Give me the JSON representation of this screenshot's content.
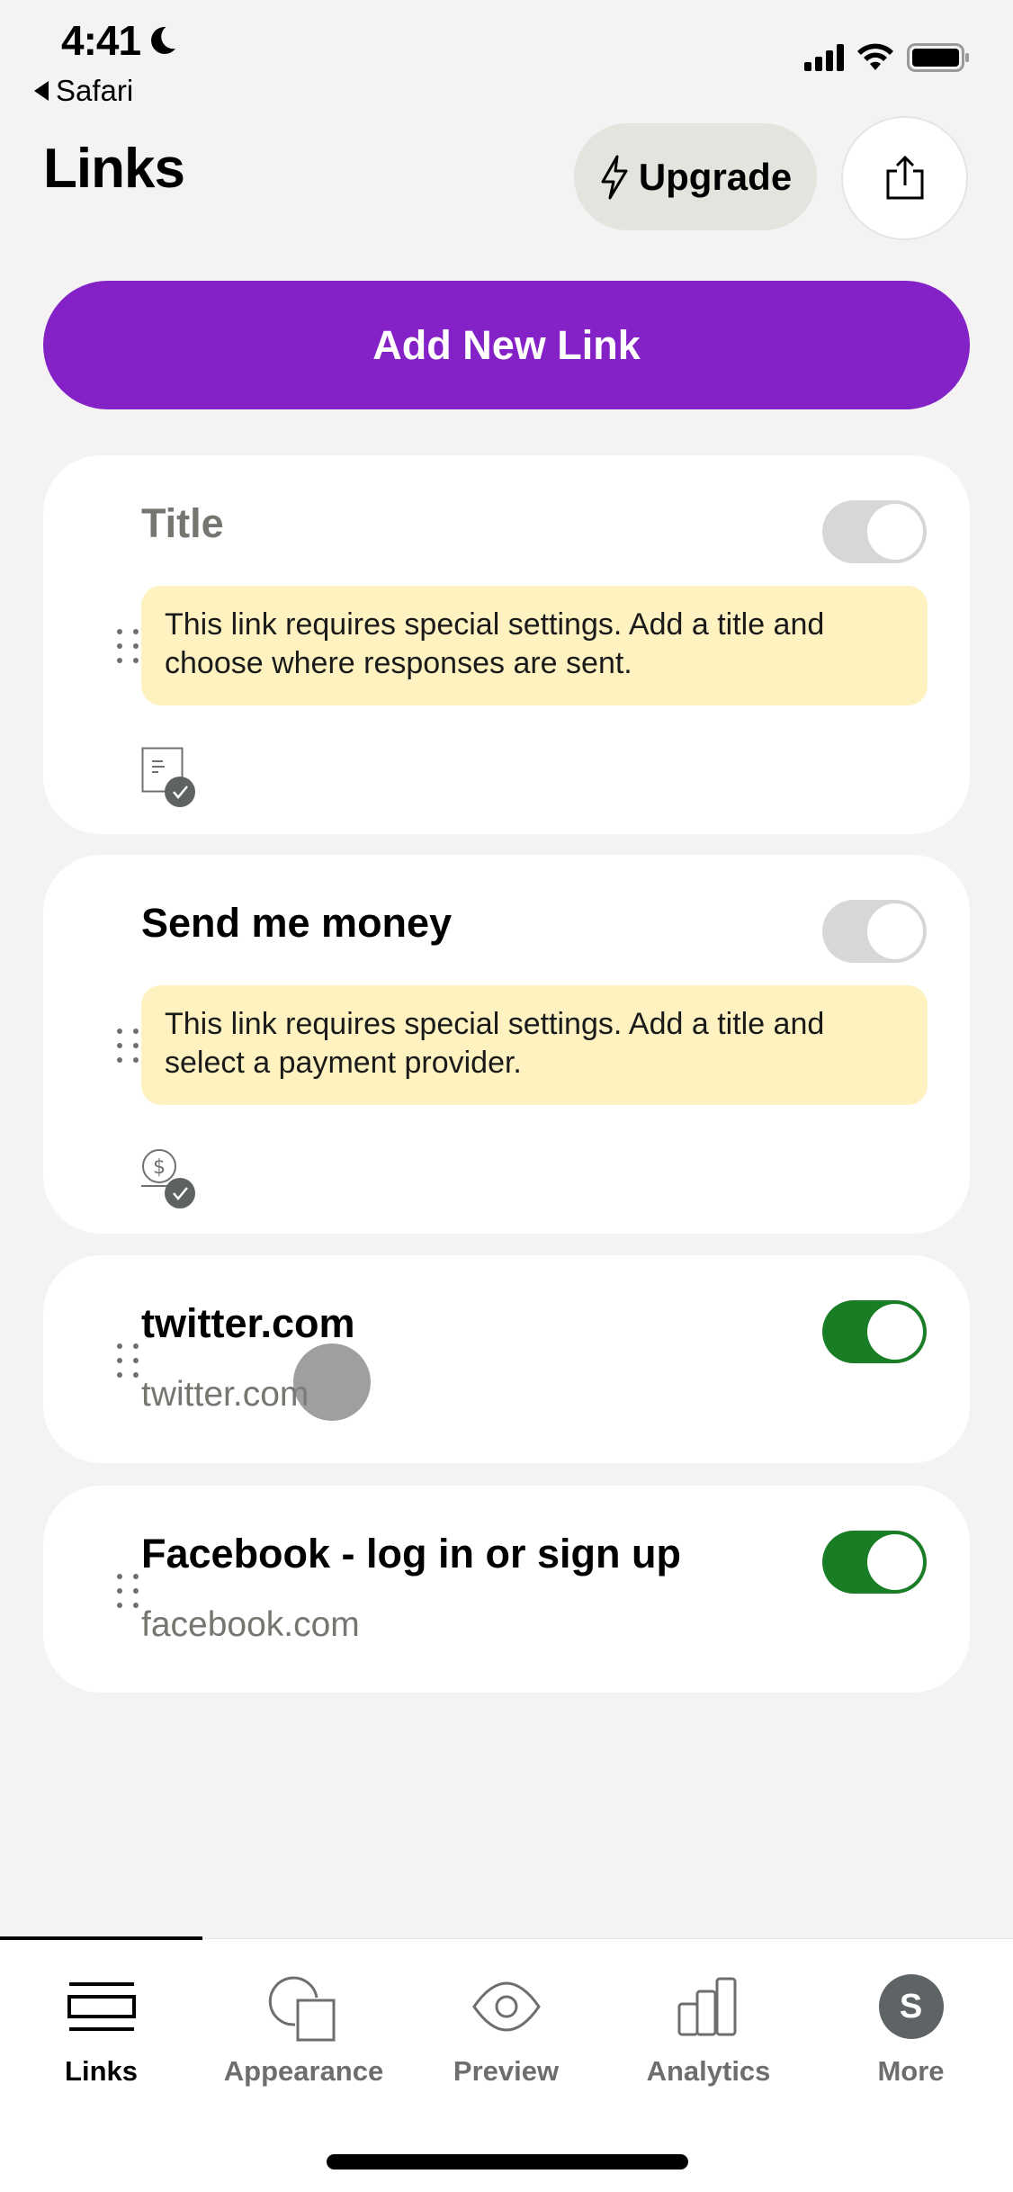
{
  "status_bar": {
    "time": "4:41",
    "back_app": "Safari"
  },
  "header": {
    "title": "Links",
    "upgrade_label": "Upgrade"
  },
  "add_button_label": "Add New Link",
  "colors": {
    "accent": "#8421c7",
    "toggle_on": "#197d26",
    "toggle_off": "#d7d7d5",
    "warning_bg": "#fef2c0",
    "background": "#f4f2f3"
  },
  "links": [
    {
      "title": "Title",
      "title_placeholder": true,
      "enabled": false,
      "warning": "This link requires special settings. Add a title and choose where responses are sent.",
      "type_icon": "form-icon"
    },
    {
      "title": "Send me money",
      "enabled": false,
      "warning": "This link requires special settings. Add a title and select a payment provider.",
      "type_icon": "payment-icon"
    },
    {
      "title": "twitter.com",
      "url": "twitter.com",
      "enabled": true
    },
    {
      "title": "Facebook - log in or sign up",
      "url": "facebook.com",
      "enabled": true
    }
  ],
  "bottom_nav": {
    "items": [
      {
        "label": "Links",
        "icon": "links-icon",
        "active": true
      },
      {
        "label": "Appearance",
        "icon": "appearance-icon",
        "active": false
      },
      {
        "label": "Preview",
        "icon": "eye-icon",
        "active": false
      },
      {
        "label": "Analytics",
        "icon": "bar-chart-icon",
        "active": false
      },
      {
        "label": "More",
        "icon": "avatar",
        "avatar_initial": "S",
        "active": false
      }
    ]
  }
}
